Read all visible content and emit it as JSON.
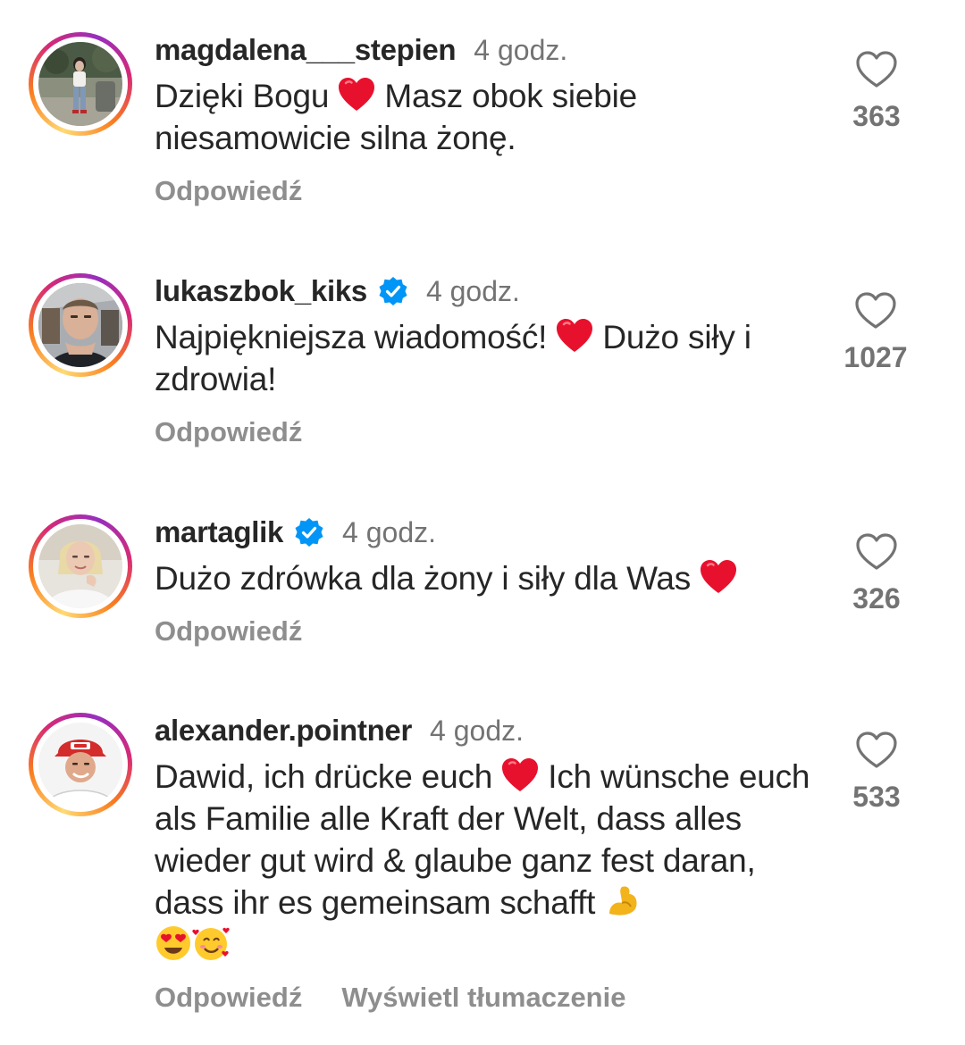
{
  "colors": {
    "text": "#262626",
    "muted": "#737373",
    "action": "#8e8e8e",
    "heart_emoji": "#e8112d",
    "verified": "#0095f6"
  },
  "comments": [
    {
      "username": "magdalena___stepien",
      "verified": false,
      "time": "4 godz.",
      "text_parts": [
        "Dzięki Bogu ",
        " Masz obok siebie niesamowicie silna żonę."
      ],
      "likes": "363",
      "reply_label": "Odpowiedź"
    },
    {
      "username": "lukaszbok_kiks",
      "verified": true,
      "time": "4 godz.",
      "text_parts": [
        "Najpiękniejsza wiadomość! ",
        " Dużo siły i zdrowia!"
      ],
      "likes": "1027",
      "reply_label": "Odpowiedź"
    },
    {
      "username": "martaglik",
      "verified": true,
      "time": "4 godz.",
      "text_parts": [
        "Dużo zdrówka dla żony i siły dla Was "
      ],
      "likes": "326",
      "reply_label": "Odpowiedź"
    },
    {
      "username": "alexander.pointner",
      "verified": false,
      "time": "4 godz.",
      "text_parts": [
        "Dawid, ich drücke euch ",
        " Ich wünsche euch als Familie alle Kraft der Welt, dass alles wieder gut wird & glaube ganz fest daran, dass ihr es gemeinsam schafft "
      ],
      "likes": "533",
      "reply_label": "Odpowiedź",
      "translate_label": "Wyświetl tłumaczenie"
    }
  ],
  "icons": {
    "like": "heart-outline-icon",
    "verified": "verified-badge-icon",
    "emoji_heart": "red-heart-emoji",
    "emoji_muscle": "flexed-biceps-emoji",
    "emoji_heart_eyes": "heart-eyes-emoji",
    "emoji_hearts_face": "smiling-face-with-hearts-emoji"
  }
}
